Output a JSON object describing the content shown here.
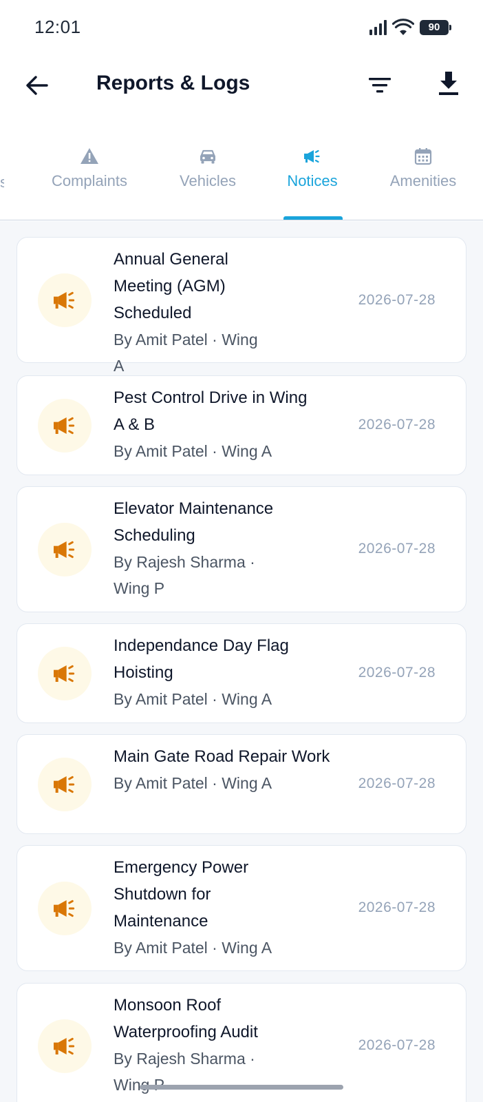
{
  "status_bar": {
    "time": "12:01",
    "battery": "90"
  },
  "app_bar": {
    "title": "Reports & Logs",
    "back_icon": "arrow-left-icon",
    "filter_icon": "filter-icon",
    "download_icon": "download-icon"
  },
  "tabs": [
    {
      "label": "Complaints",
      "icon": "warning-triangle-icon",
      "active": false
    },
    {
      "label": "Vehicles",
      "icon": "car-icon",
      "active": false
    },
    {
      "label": "Notices",
      "icon": "megaphone-icon",
      "active": true
    },
    {
      "label": "Amenities",
      "icon": "calendar-icon",
      "active": false
    }
  ],
  "colors": {
    "accent": "#1aa4db",
    "notice_icon": "#d97706",
    "notice_icon_bg": "#fef9e7"
  },
  "notices": [
    {
      "title": "Annual General Meeting (AGM) Scheduled",
      "meta": "By Amit Patel · Wing A",
      "date": "2026-07-28"
    },
    {
      "title": "Pest Control Drive in Wing A & B",
      "meta": "By Amit Patel · Wing A",
      "date": "2026-07-28"
    },
    {
      "title": "Elevator Maintenance Scheduling",
      "meta": "By Rajesh Sharma · Wing P",
      "date": "2026-07-28"
    },
    {
      "title": "Independance Day Flag Hoisting",
      "meta": "By Amit Patel · Wing A",
      "date": "2026-07-28"
    },
    {
      "title": "Main Gate Road Repair Work",
      "meta": "By Amit Patel · Wing A",
      "date": "2026-07-28"
    },
    {
      "title": "Emergency Power Shutdown for Maintenance",
      "meta": "By Amit Patel · Wing A",
      "date": "2026-07-28"
    },
    {
      "title": "Monsoon Roof Waterproofing Audit",
      "meta": "By Rajesh Sharma · Wing P",
      "date": "2026-07-28"
    }
  ]
}
